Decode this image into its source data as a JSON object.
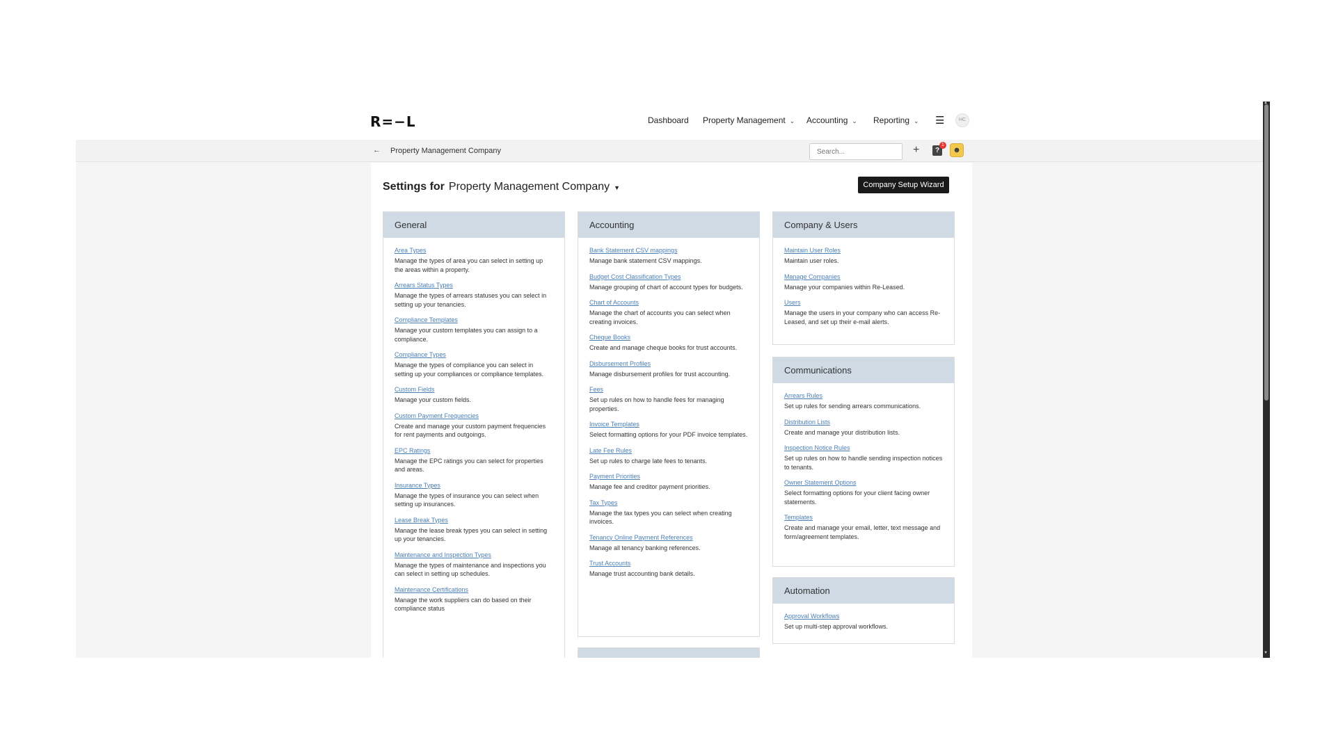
{
  "nav": {
    "logo": "R=−L",
    "items": [
      {
        "label": "Dashboard",
        "dropdown": false
      },
      {
        "label": "Property Management",
        "dropdown": true
      },
      {
        "label": "Accounting",
        "dropdown": true
      },
      {
        "label": "Reporting",
        "dropdown": true
      }
    ],
    "user_initials": "HC"
  },
  "subbar": {
    "breadcrumb": "Property Management Company",
    "search_placeholder": "Search...",
    "notification_count": "1"
  },
  "page": {
    "heading_prefix": "Settings for",
    "company_name": "Property Management Company",
    "wizard_button": "Company Setup Wizard"
  },
  "sections": {
    "general": {
      "title": "General",
      "items": [
        {
          "link": "Area Types",
          "desc": "Manage the types of area you can select in setting up the areas within a property."
        },
        {
          "link": "Arrears Status Types",
          "desc": "Manage the types of arrears statuses you can select in setting up your tenancies."
        },
        {
          "link": "Compliance Templates",
          "desc": "Manage your custom templates you can assign to a compliance."
        },
        {
          "link": "Compliance Types",
          "desc": "Manage the types of compliance you can select in setting up your compliances or compliance templates."
        },
        {
          "link": "Custom Fields",
          "desc": "Manage your custom fields."
        },
        {
          "link": "Custom Payment Frequencies",
          "desc": "Create and manage your custom payment frequencies for rent payments and outgoings."
        },
        {
          "link": "EPC Ratings",
          "desc": "Manage the EPC ratings you can select for properties and areas."
        },
        {
          "link": "Insurance Types",
          "desc": "Manage the types of insurance you can select when setting up insurances."
        },
        {
          "link": "Lease Break Types",
          "desc": "Manage the lease break types you can select in setting up your tenancies."
        },
        {
          "link": "Maintenance and Inspection Types",
          "desc": "Manage the types of maintenance and inspections you can select in setting up schedules."
        },
        {
          "link": "Maintenance Certifications",
          "desc": "Manage the work suppliers can do based on their compliance status"
        }
      ]
    },
    "accounting": {
      "title": "Accounting",
      "items": [
        {
          "link": "Bank Statement CSV mappings",
          "desc": "Manage bank statement CSV mappings."
        },
        {
          "link": "Budget Cost Classification Types",
          "desc": "Manage grouping of chart of account types for budgets."
        },
        {
          "link": "Chart of Accounts",
          "desc": "Manage the chart of accounts you can select when creating invoices."
        },
        {
          "link": "Cheque Books",
          "desc": "Create and manage cheque books for trust accounts."
        },
        {
          "link": "Disbursement Profiles",
          "desc": "Manage disbursement profiles for trust accounting."
        },
        {
          "link": "Fees",
          "desc": "Set up rules on how to handle fees for managing properties."
        },
        {
          "link": "Invoice Templates",
          "desc": "Select formatting options for your PDF invoice templates."
        },
        {
          "link": "Late Fee Rules",
          "desc": "Set up rules to charge late fees to tenants."
        },
        {
          "link": "Payment Priorities",
          "desc": "Manage fee and creditor payment priorities."
        },
        {
          "link": "Tax Types",
          "desc": "Manage the tax types you can select when creating invoices."
        },
        {
          "link": "Tenancy Online Payment References",
          "desc": "Manage all tenancy banking references."
        },
        {
          "link": "Trust Accounts",
          "desc": "Manage trust accounting bank details."
        }
      ]
    },
    "company_users": {
      "title": "Company & Users",
      "items": [
        {
          "link": "Maintain User Roles",
          "desc": "Maintain user roles."
        },
        {
          "link": "Manage Companies",
          "desc": "Manage your companies within Re-Leased."
        },
        {
          "link": "Users",
          "desc": "Manage the users in your company who can access Re-Leased, and set up their e-mail alerts."
        }
      ]
    },
    "communications": {
      "title": "Communications",
      "items": [
        {
          "link": "Arrears Rules",
          "desc": "Set up rules for sending arrears communications."
        },
        {
          "link": "Distribution Lists",
          "desc": "Create and manage your distribution lists."
        },
        {
          "link": "Inspection Notice Rules",
          "desc": "Set up rules on how to handle sending inspection notices to tenants."
        },
        {
          "link": "Owner Statement Options",
          "desc": "Select formatting options for your client facing owner statements."
        },
        {
          "link": "Templates",
          "desc": "Create and manage your email, letter, text message and form/agreement templates."
        }
      ]
    },
    "automation": {
      "title": "Automation",
      "items": [
        {
          "link": "Approval Workflows",
          "desc": "Set up multi-step approval workflows."
        }
      ]
    }
  }
}
